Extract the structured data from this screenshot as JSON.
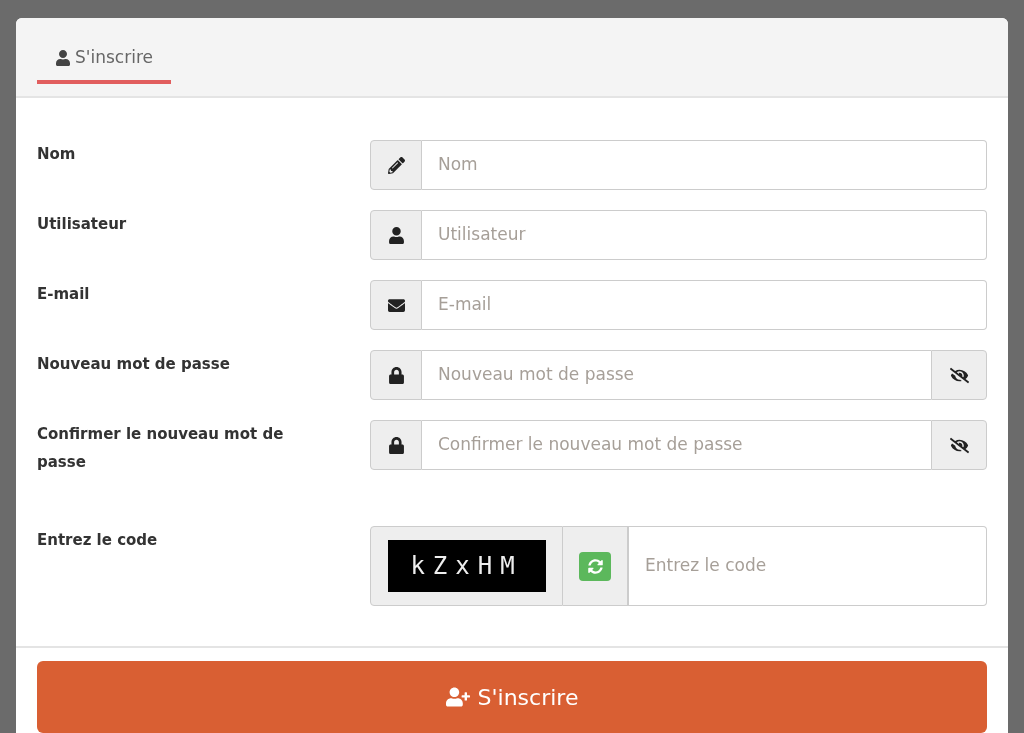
{
  "tabs": [
    {
      "label": "S'inscrire",
      "selected": true
    }
  ],
  "fields": [
    {
      "kind": "name",
      "label": "Nom",
      "placeholder": "Nom"
    },
    {
      "kind": "user",
      "label": "Utilisateur",
      "placeholder": "Utilisateur"
    },
    {
      "kind": "email",
      "label": "E-mail",
      "placeholder": "E-mail"
    },
    {
      "kind": "password",
      "label": "Nouveau mot de passe",
      "placeholder": "Nouveau mot de passe"
    },
    {
      "kind": "password",
      "label": "Confirmer le nouveau mot de passe",
      "placeholder": "Confirmer le nouveau mot de passe"
    }
  ],
  "captcha": {
    "label": "Entrez le code",
    "code": "kZxHM",
    "placeholder": "Entrez le code"
  },
  "submit": {
    "label": "S'inscrire"
  }
}
